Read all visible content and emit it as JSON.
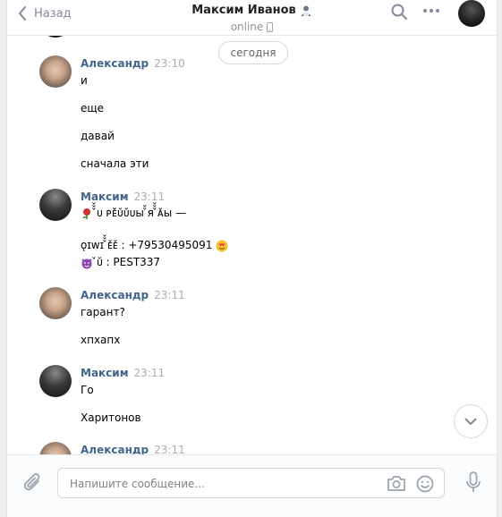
{
  "header": {
    "back_label": "Назад",
    "contact_name": "Максим Иванов",
    "status": "online"
  },
  "date_divider": "сегодня",
  "messages": [
    {
      "author": "Александр",
      "time": "23:10",
      "lines": [
        "и",
        "еще",
        "давай",
        "сначала эти"
      ]
    },
    {
      "author": "Максим",
      "time": "23:11",
      "lines": [
        "̌̌̌ᴜ ᴘᴇ̌̌ᴜ̌ᴜ̌ᴜы ̌̌я ̌̌̌ᴀ̌ы —",
        "ǫɪᴡɪ ̌̌̌ᴇ̌ᴇ̌ : +79530495091",
        "̌ᴜ̌ : PEST337"
      ]
    },
    {
      "author": "Александр",
      "time": "23:11",
      "lines": [
        "гарант?",
        "хпхапх"
      ]
    },
    {
      "author": "Максим",
      "time": "23:11",
      "lines": [
        "Го",
        "Харитонов"
      ]
    },
    {
      "author": "Александр",
      "time": "23:11",
      "lines": []
    }
  ],
  "composer": {
    "placeholder": "Напишите сообщение..."
  },
  "icons": {
    "back": "chevron-left-icon",
    "search": "search-icon",
    "more": "more-horizontal-icon",
    "attach": "paperclip-icon",
    "camera": "camera-icon",
    "smile": "smile-icon",
    "mic": "microphone-icon",
    "scroll_down": "chevron-down-icon"
  },
  "colors": {
    "author": "#42648b",
    "accent": "#5181b8",
    "background": "#edeef0"
  }
}
